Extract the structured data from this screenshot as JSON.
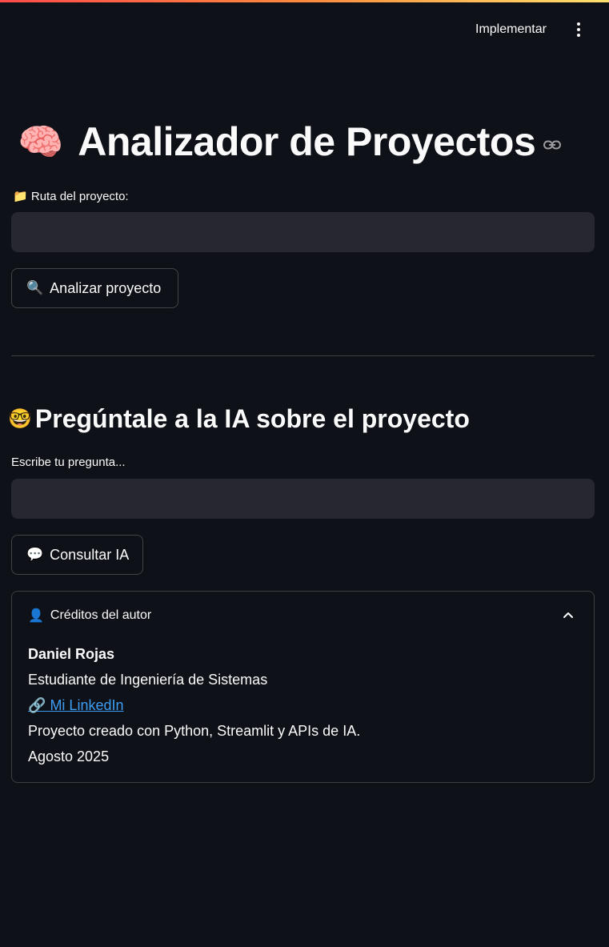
{
  "header": {
    "deploy_label": "Implementar",
    "menu_icon": "more-vertical-icon"
  },
  "page": {
    "title_emoji": "🧠",
    "title": "Analizador de Proyectos",
    "title_anchor_icon": "link-icon"
  },
  "project_path": {
    "label_emoji": "📁",
    "label": "Ruta del proyecto:",
    "value": "",
    "placeholder": ""
  },
  "analyze_button": {
    "emoji": "🔍",
    "label": "Analizar proyecto"
  },
  "ask_section": {
    "emoji": "🤓",
    "title": "Pregúntale a la IA sobre el proyecto",
    "input_label": "Escribe tu pregunta...",
    "input_value": "",
    "input_placeholder": ""
  },
  "consult_button": {
    "emoji": "💬",
    "label": "Consultar IA"
  },
  "credits": {
    "header_emoji": "👤",
    "header": "Créditos del autor",
    "expanded": true,
    "author_name": "Daniel Rojas",
    "role": "Estudiante de Ingeniería de Sistemas",
    "link_emoji": "🔗",
    "link_label": "Mi LinkedIn",
    "description": "Proyecto creado con Python, Streamlit y APIs de IA.",
    "date": "Agosto 2025"
  },
  "colors": {
    "background": "#0e1117",
    "input_bg": "#262730",
    "link": "#3d9df3",
    "text": "#fafafa"
  }
}
